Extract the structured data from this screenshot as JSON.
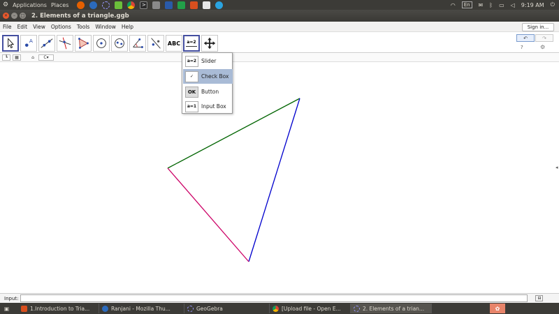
{
  "topbar": {
    "applications": "Applications",
    "places": "Places",
    "keyboard": "En",
    "clock": "9:19 AM"
  },
  "window": {
    "title": "2. Elements of a triangle.ggb"
  },
  "menubar": {
    "items": [
      "File",
      "Edit",
      "View",
      "Options",
      "Tools",
      "Window",
      "Help"
    ],
    "signin": "Sign in..."
  },
  "toolbar": {
    "text_tool": "ABC",
    "slider_tool": "a=2"
  },
  "stylebar": {
    "label_style": "C"
  },
  "dropdown": {
    "items": [
      {
        "label": "Slider",
        "icon": "a=2"
      },
      {
        "label": "Check Box",
        "icon": "✓"
      },
      {
        "label": "Button",
        "icon": "OK"
      },
      {
        "label": "Input Box",
        "icon": "a=1"
      }
    ]
  },
  "triangle": {
    "colors": {
      "top": "#006400",
      "right": "#0000cd",
      "left": "#cc0066"
    }
  },
  "inputbar": {
    "label": "Input:"
  },
  "taskbar": {
    "tasks": [
      "1.Introduction to Tria...",
      "Ranjani - Mozilla Thu...",
      "GeoGebra",
      "[Upload file - Open E...",
      "2. Elements of a trian..."
    ]
  }
}
